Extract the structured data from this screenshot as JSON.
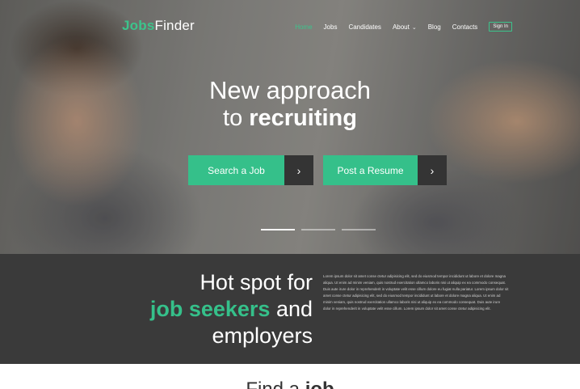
{
  "nav": {
    "logo_part1": "Jobs",
    "logo_part2": "Finder",
    "items": [
      {
        "label": "Home",
        "active": true
      },
      {
        "label": "Jobs"
      },
      {
        "label": "Candidates"
      },
      {
        "label": "About",
        "has_dropdown": true
      },
      {
        "label": "Blog"
      },
      {
        "label": "Contacts"
      }
    ],
    "signin_label": "Sign In"
  },
  "hero": {
    "line1": "New approach",
    "line2_lead": "to",
    "line2_bold": "recruiting",
    "buttons": [
      {
        "label": "Search a Job",
        "arrow_icon": "chevron-right-icon"
      },
      {
        "label": "Post a Resume",
        "arrow_icon": "chevron-right-icon"
      }
    ],
    "slides_total": 3,
    "slide_active_index": 0
  },
  "band": {
    "title_line1": "Hot spot for",
    "title_line2_green": "job seekers",
    "title_line2_rest": "and",
    "title_line3": "employers",
    "body": "Lorem ipsum dolor sit amet conse ctetur adipisicing elit, sed do eiusmod tempor incididunt ut labore et dolore magna aliqua. Ut enim ad minim veniam, quis nostrud exercitation ullamco laboris nisi ut aliquip ex ea commodo consequat. Duis aute irure dolor in reprehenderit in voluptate velit esse cillum dolore eu fugiat nulla pariatur. Lorem ipsum dolor sit amet conse ctetur adipisicing elit, sed do eiusmod tempor incididunt ut labore et dolore magna aliqua. Ut enim ad minim veniam, quis nostrud exercitation ullamco laboris nisi ut aliquip ex ea commodo consequat. Duis aute irure dolor in reprehenderit in voluptate velit esse cillum. Lorem ipsum dolor sit amet conse ctetur adipisicing elit."
  },
  "bottom": {
    "title_lead": "Find a",
    "title_bold": "job"
  },
  "colors": {
    "accent": "#35c08a",
    "dark_band": "#3a3a3a",
    "arrow_button": "#343434"
  }
}
